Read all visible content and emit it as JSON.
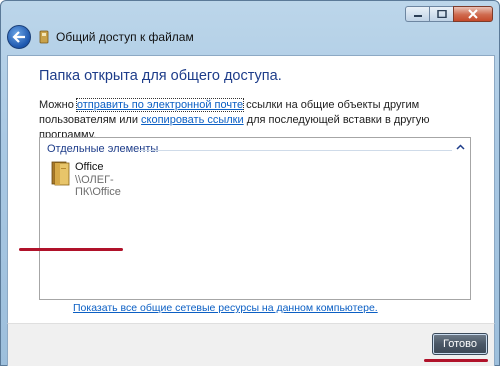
{
  "window": {
    "title": "Общий доступ к файлам",
    "buttons": [
      "minimize-icon",
      "maximize-icon",
      "close-icon"
    ]
  },
  "main": {
    "heading": "Папка открыта для общего доступа.",
    "desc_prefix": "Можно ",
    "link_email": "отправить по электронной почте",
    "desc_middle": " ссылки на общие объекты другим пользователям или ",
    "link_copy": "скопировать ссылки",
    "desc_suffix": " для последующей вставки в другую программу.",
    "group_title": "Отдельные элементы",
    "items": [
      {
        "name": "Office",
        "path": "\\\\ОЛЕГ-ПК\\Office",
        "icon": "folder-icon"
      }
    ],
    "show_all_link": "Показать все общие сетевые ресурсы на данном компьютере."
  },
  "footer": {
    "done_label": "Готово"
  },
  "colors": {
    "heading": "#1e3d8a",
    "link": "#0b5fc4",
    "annotation_red": "#b0122a"
  }
}
